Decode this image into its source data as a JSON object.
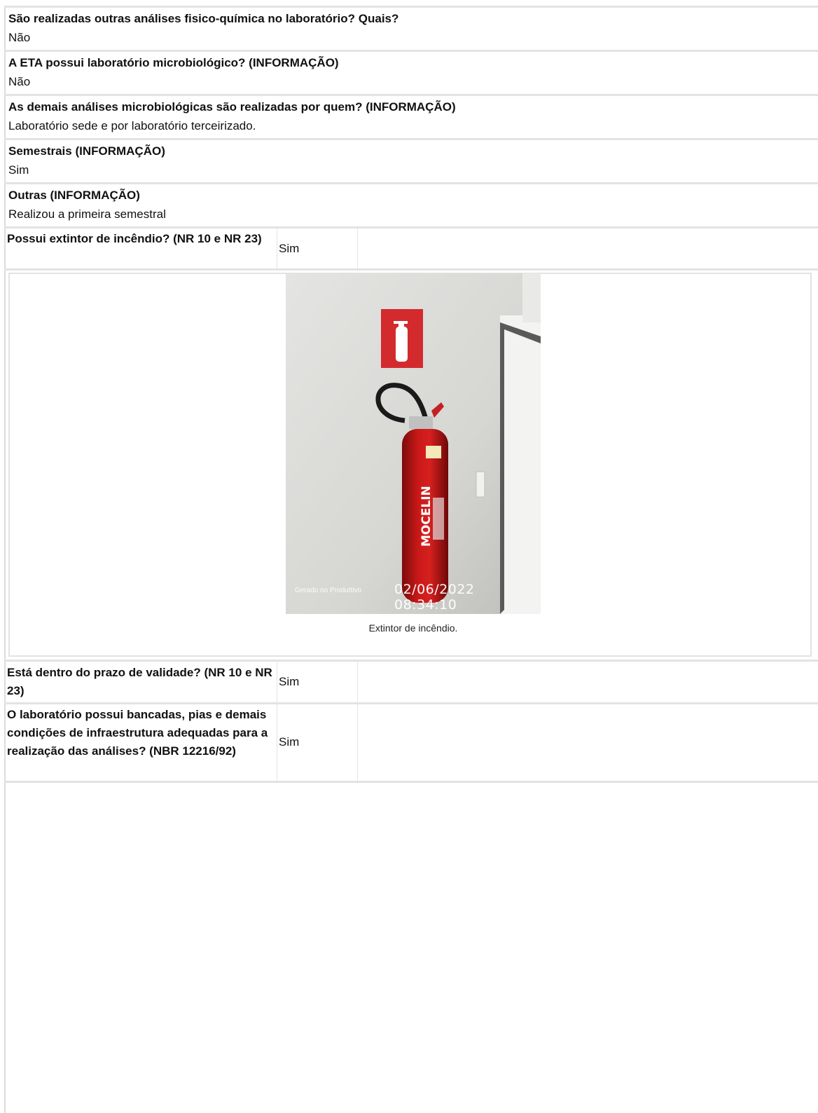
{
  "rows": [
    {
      "question": "São realizadas outras análises fisico-química no laboratório? Quais?",
      "answer": "Não"
    },
    {
      "question": "A ETA possui laboratório microbiológico? (INFORMAÇÃO)",
      "answer": "Não"
    },
    {
      "question": "As demais análises microbiológicas são realizadas por quem? (INFORMAÇÃO)",
      "answer": "Laboratório sede e por laboratório terceirizado."
    },
    {
      "question": "Semestrais (INFORMAÇÃO)",
      "answer": "Sim"
    },
    {
      "question": "Outras (INFORMAÇÃO)",
      "answer": "Realizou a primeira semestral"
    }
  ],
  "table_rows": [
    {
      "question": "Possui extintor de incêndio? (NR 10 e NR 23)",
      "answer": "Sim"
    },
    {
      "question": "Está dentro do prazo de validade? (NR 10 e NR 23)",
      "answer": "Sim"
    },
    {
      "question": "O laboratório possui bancadas, pias e demais condições de infraestrutura adequadas para a realização das análises? (NBR 12216/92)",
      "answer": "Sim"
    }
  ],
  "photo": {
    "watermark_app": "Gerado no Produttivo",
    "watermark_datetime": "02/06/2022 08:34:10",
    "extinguisher_brand": "MOCELIN",
    "caption": "Extintor de incêndio."
  }
}
